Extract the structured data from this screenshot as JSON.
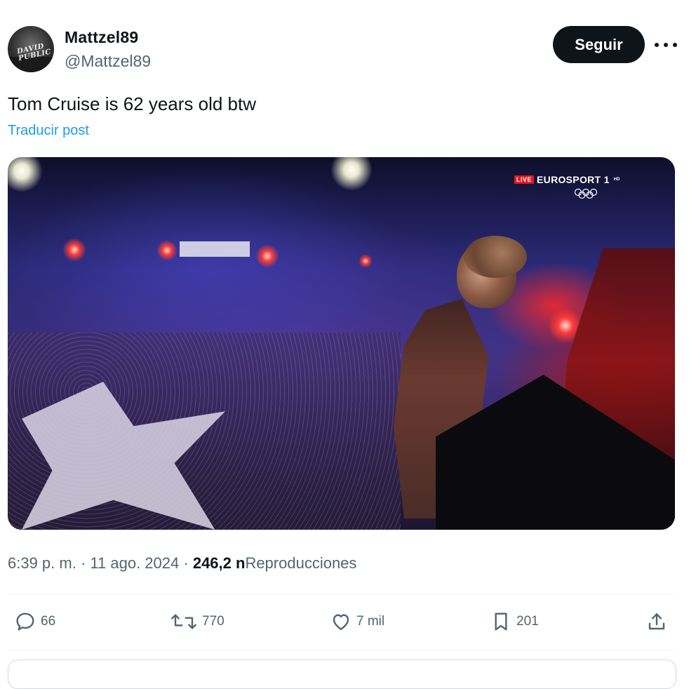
{
  "author": {
    "display_name": "Mattzel89",
    "handle": "@Mattzel89",
    "avatar_text": "DAVID PUBLIC"
  },
  "follow_button": {
    "label": "Seguir"
  },
  "more_icon": "more-horizontal-icon",
  "post": {
    "text": "Tom Cruise is 62 years old btw",
    "translate_label": "Traducir post"
  },
  "media": {
    "live_badge": "LIVE",
    "channel": "EUROSPORT 1",
    "hd": "HD",
    "stadium_banner": "",
    "description_icon": "olympic-rings-icon"
  },
  "meta": {
    "time": "6:39 p. m.",
    "separator": "·",
    "date": "11 ago. 2024",
    "views_count": "246,2 n",
    "views_label": "Reproducciones"
  },
  "actions": {
    "replies": "66",
    "reposts": "770",
    "likes": "7 mil",
    "bookmarks": "201"
  },
  "colors": {
    "text_primary": "#0f1419",
    "text_secondary": "#536471",
    "link": "#1d9bf0",
    "follow_bg": "#0f1419",
    "divider": "#eff3f4"
  }
}
